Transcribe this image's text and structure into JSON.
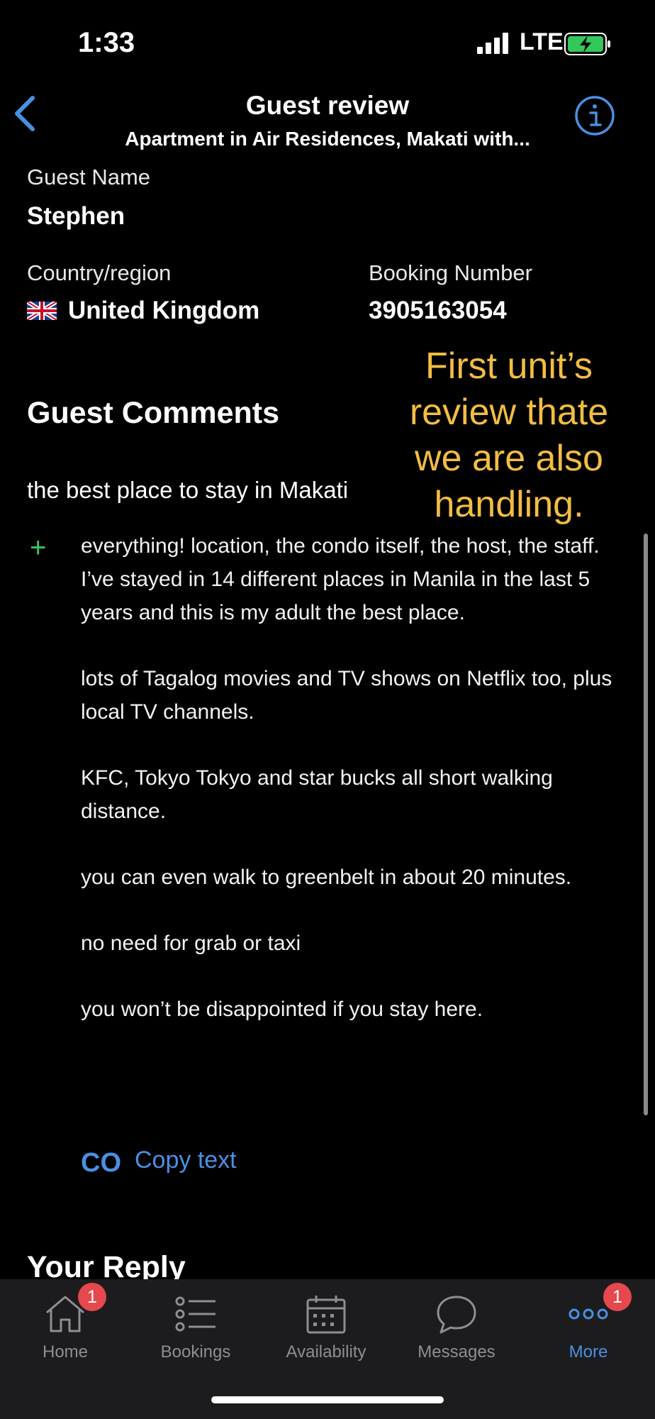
{
  "status_bar": {
    "time": "1:33",
    "network": "LTE"
  },
  "nav": {
    "title": "Guest review",
    "subtitle": "Apartment in Air Residences, Makati with..."
  },
  "guest": {
    "name_label": "Guest Name",
    "name": "Stephen",
    "country_label": "Country/region",
    "country": "United Kingdom",
    "booking_label": "Booking Number",
    "booking_number": "3905163054"
  },
  "annotation": {
    "lines": [
      "First unit’s",
      "review thate",
      "we are also",
      "handling."
    ]
  },
  "comments": {
    "section_title": "Guest Comments",
    "review_title": "the best place to stay in Makati",
    "positive_paragraphs": [
      "everything! location, the condo itself, the host, the staff. I’ve stayed in 14 different places in Manila in the last 5 years and this is my adult the best place.",
      "lots of Tagalog movies and TV shows on Netflix too, plus local TV channels.",
      "KFC, Tokyo Tokyo and star bucks all short walking distance.",
      "you can even walk to greenbelt in about 20 minutes.",
      "no need for grab or taxi",
      "you won’t be disappointed if you stay here."
    ],
    "copy_icon_text": "CO",
    "copy_label": "Copy text"
  },
  "reply": {
    "section_title": "Your Reply"
  },
  "tabbar": {
    "tabs": [
      {
        "label": "Home",
        "icon": "house-icon",
        "badge": "1"
      },
      {
        "label": "Bookings",
        "icon": "list-icon"
      },
      {
        "label": "Availability",
        "icon": "calendar-icon"
      },
      {
        "label": "Messages",
        "icon": "chat-bubble-icon"
      },
      {
        "label": "More",
        "icon": "more-dots-icon",
        "badge": "1",
        "active": true
      }
    ]
  },
  "colors": {
    "accent": "#4a90e2",
    "annotation": "#f2bd42",
    "plus": "#41c25b",
    "badge": "#e5484d"
  }
}
